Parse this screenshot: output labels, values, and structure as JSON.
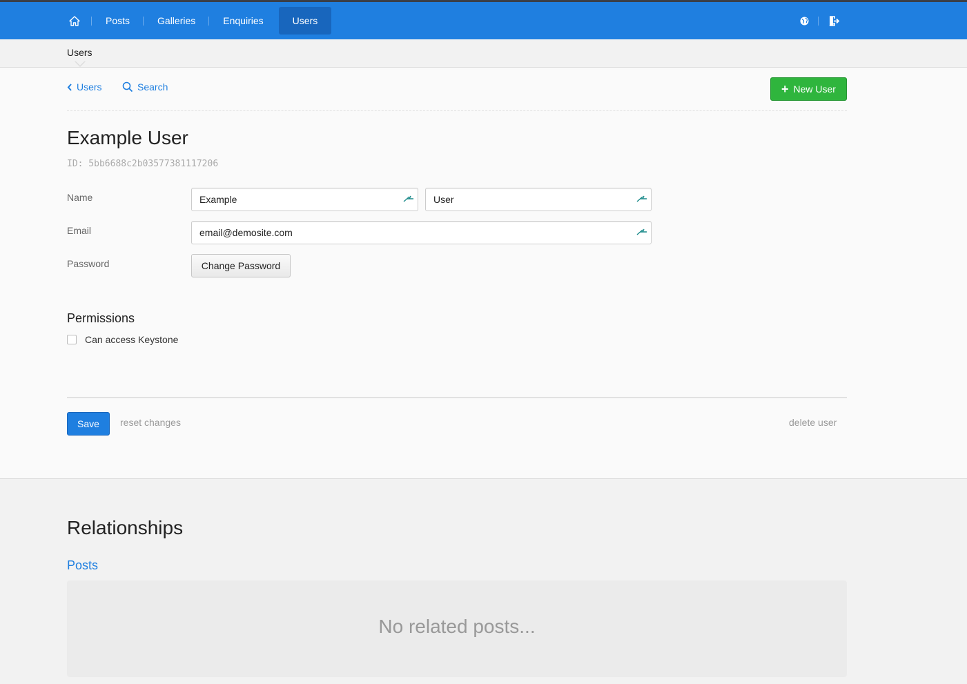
{
  "topnav": {
    "items": [
      {
        "label": "Posts"
      },
      {
        "label": "Galleries"
      },
      {
        "label": "Enquiries"
      },
      {
        "label": "Users",
        "active": true
      }
    ]
  },
  "breadcrumb": {
    "current": "Users"
  },
  "toolbar": {
    "back_label": "Users",
    "search_label": "Search",
    "new_label": "New User"
  },
  "item": {
    "title": "Example User",
    "id_label": "ID: 5bb6688c2b03577381117206"
  },
  "form": {
    "name_label": "Name",
    "first_name": "Example",
    "last_name": "User",
    "email_label": "Email",
    "email": "email@demosite.com",
    "password_label": "Password",
    "change_password_label": "Change Password"
  },
  "permissions": {
    "heading": "Permissions",
    "can_access_label": "Can access Keystone",
    "can_access_checked": false
  },
  "actions": {
    "save_label": "Save",
    "reset_label": "reset changes",
    "delete_label": "delete user"
  },
  "relationships": {
    "heading": "Relationships",
    "posts_label": "Posts",
    "posts_empty": "No related posts..."
  },
  "colors": {
    "primary": "#1f7fe0",
    "success": "#2fb53d",
    "topbar": "#1f7fe0"
  },
  "icons": [
    "home-icon",
    "globe-icon",
    "sign-out-icon",
    "chevron-left-icon",
    "search-icon",
    "plus-icon",
    "autofill-key-icon"
  ]
}
